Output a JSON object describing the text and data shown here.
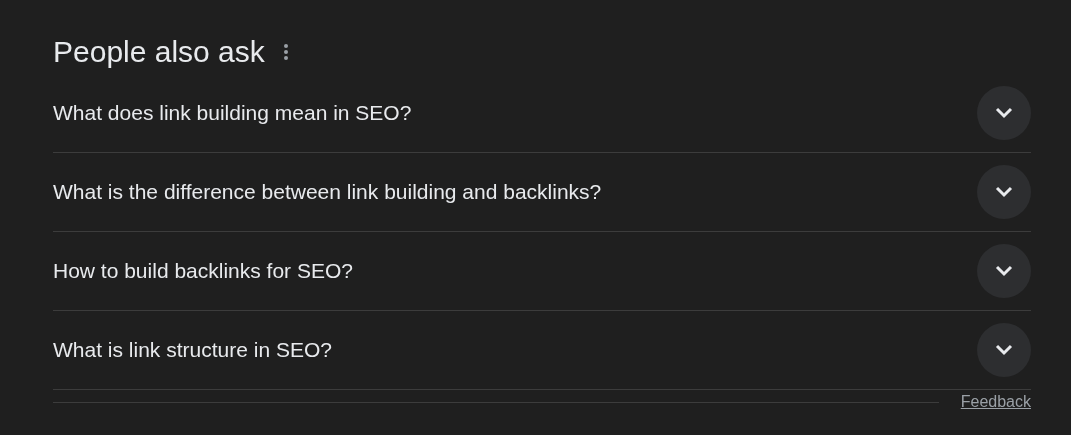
{
  "heading": "People also ask",
  "questions": [
    {
      "text": "What does link building mean in SEO?",
      "expanded": false
    },
    {
      "text": "What is the difference between link building and backlinks?",
      "expanded": false
    },
    {
      "text": "How to build backlinks for SEO?",
      "expanded": false
    },
    {
      "text": "What is link structure in SEO?",
      "expanded": false
    }
  ],
  "feedback": "Feedback"
}
